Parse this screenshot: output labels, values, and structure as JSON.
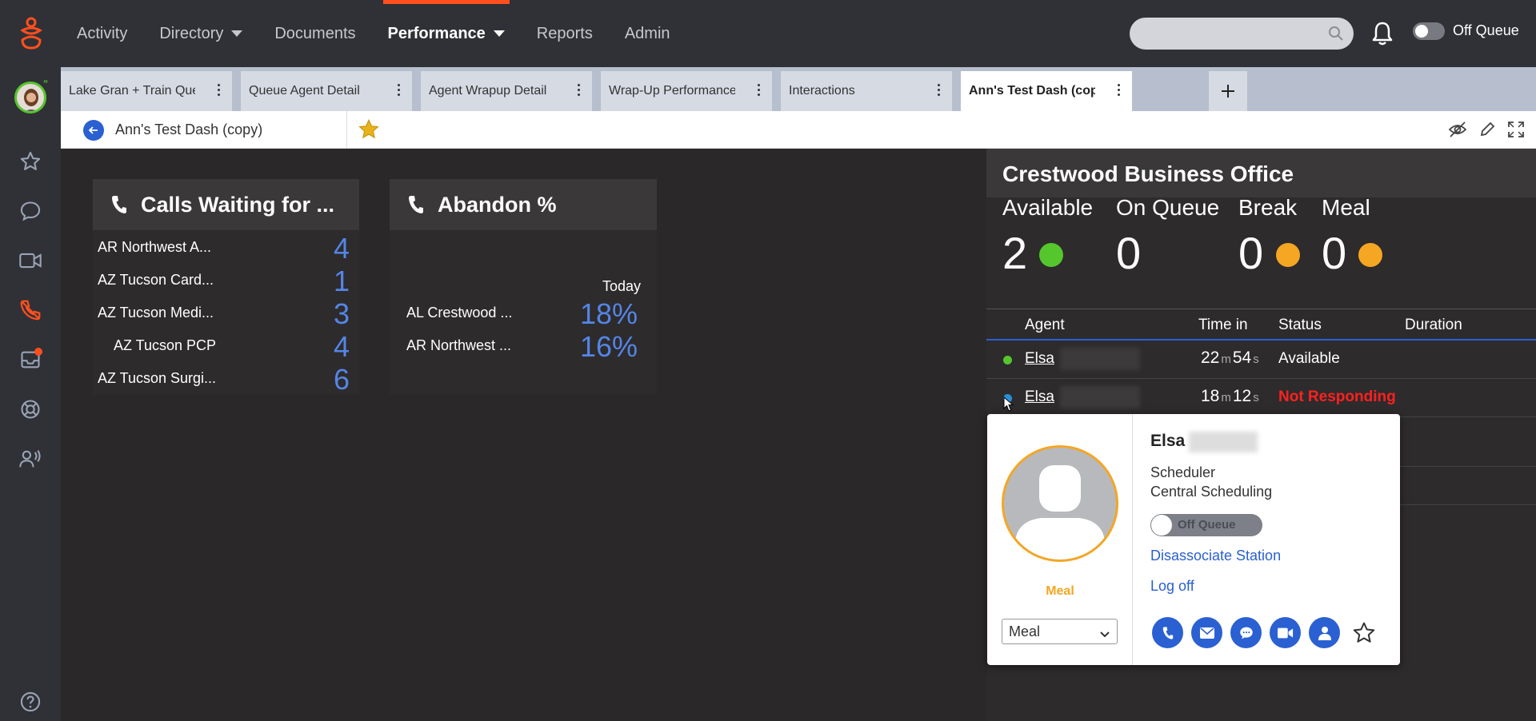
{
  "nav": {
    "items": [
      {
        "label": "Activity",
        "dropdown": false,
        "active": false
      },
      {
        "label": "Directory",
        "dropdown": true,
        "active": false
      },
      {
        "label": "Documents",
        "dropdown": false,
        "active": false
      },
      {
        "label": "Performance",
        "dropdown": true,
        "active": true
      },
      {
        "label": "Reports",
        "dropdown": false,
        "active": false
      },
      {
        "label": "Admin",
        "dropdown": false,
        "active": false
      }
    ],
    "queue_status": "Off Queue",
    "accent_color": "#ff4f1f"
  },
  "sidebar": {
    "icons": [
      "favorites-icon",
      "chat-icon",
      "video-icon",
      "phone-icon",
      "inbox-icon",
      "help-ring-icon",
      "agents-icon",
      "help-icon"
    ]
  },
  "tabs": [
    {
      "label": "Lake Gran + Train Que",
      "active": false
    },
    {
      "label": "Queue Agent Detail",
      "active": false
    },
    {
      "label": "Agent Wrapup Detail",
      "active": false
    },
    {
      "label": "Wrap-Up Performance",
      "active": false
    },
    {
      "label": "Interactions",
      "active": false
    },
    {
      "label": "Ann's Test Dash (cop",
      "active": true
    }
  ],
  "dashboard": {
    "title": "Ann's Test Dash (copy)"
  },
  "widgets": {
    "calls_waiting": {
      "title": "Calls Waiting for ...",
      "rows": [
        {
          "label": "AR Northwest A...",
          "value": "4"
        },
        {
          "label": "AZ Tucson Card...",
          "value": "1"
        },
        {
          "label": "AZ Tucson Medi...",
          "value": "3"
        },
        {
          "label": "AZ Tucson PCP",
          "value": "4"
        },
        {
          "label": "AZ Tucson Surgi...",
          "value": "6"
        }
      ]
    },
    "abandon": {
      "title": "Abandon %",
      "period": "Today",
      "rows": [
        {
          "label": "AL Crestwood ...",
          "value": "18%"
        },
        {
          "label": "AR Northwest ...",
          "value": "16%"
        }
      ]
    }
  },
  "office": {
    "title": "Crestwood Business Office",
    "stats": [
      {
        "label": "Available",
        "value": "2",
        "color": "#56c62d"
      },
      {
        "label": "On Queue",
        "value": "0"
      },
      {
        "label": "Break",
        "value": "0",
        "color": "#f5a623"
      },
      {
        "label": "Meal",
        "value": "0",
        "color": "#f5a623"
      }
    ],
    "columns": {
      "agent": "Agent",
      "time_in": "Time in",
      "status": "Status",
      "duration": "Duration"
    },
    "agents": [
      {
        "name": "Elsa",
        "min": "22",
        "sec": "54",
        "unit_m": "m",
        "unit_s": "s",
        "status": "Available",
        "status_color": "#ffffff",
        "dot_color": "#56c62d"
      },
      {
        "name": "Elsa",
        "min": "18",
        "sec": "12",
        "unit_m": "m",
        "unit_s": "s",
        "status": "Not Responding",
        "status_color": "#ff2020",
        "dot_color": "#2a8fd6"
      }
    ]
  },
  "profile_card": {
    "first_name": "Elsa",
    "presence": "Meal",
    "presence_select": "Meal",
    "title": "Scheduler",
    "department": "Central Scheduling",
    "queue_toggle": "Off Queue",
    "disassociate": "Disassociate Station",
    "logoff": "Log off",
    "actions": [
      "phone-icon",
      "email-icon",
      "chat-icon",
      "video-icon",
      "profile-icon",
      "favorite-star-icon"
    ],
    "presence_color": "#f5a623"
  }
}
